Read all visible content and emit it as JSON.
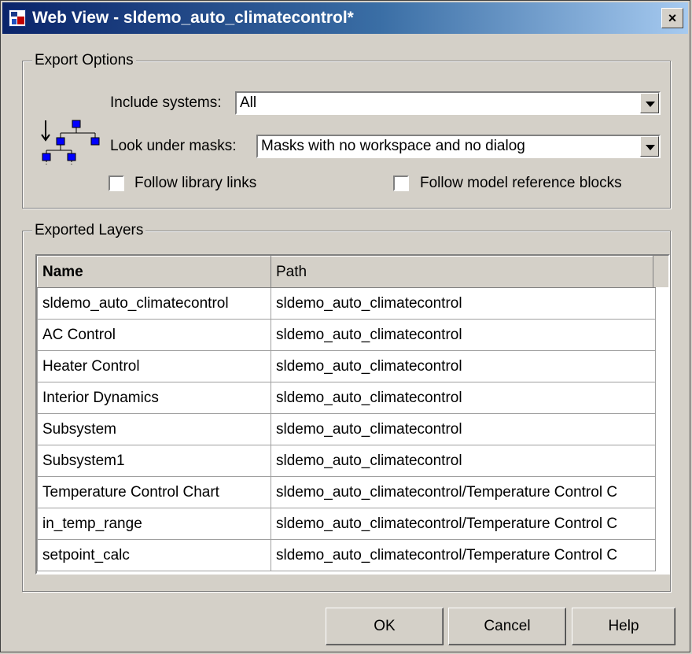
{
  "window": {
    "title": "Web View - sldemo_auto_climatecontrol*",
    "close_glyph": "×"
  },
  "export_options": {
    "legend": "Export Options",
    "include_systems_label": "Include systems:",
    "include_systems_value": "All",
    "look_under_masks_label": "Look under masks:",
    "look_under_masks_value": "Masks with no workspace and no dialog",
    "follow_library_links_label": "Follow library links",
    "follow_library_links_checked": false,
    "follow_model_ref_label": "Follow model reference blocks",
    "follow_model_ref_checked": false,
    "hierarchy_icon": "hierarchy-icon"
  },
  "exported_layers": {
    "legend": "Exported Layers",
    "columns": [
      "Name",
      "Path"
    ],
    "rows": [
      [
        "sldemo_auto_climatecontrol",
        "sldemo_auto_climatecontrol"
      ],
      [
        "AC Control",
        "sldemo_auto_climatecontrol"
      ],
      [
        "Heater Control",
        "sldemo_auto_climatecontrol"
      ],
      [
        "Interior Dynamics",
        "sldemo_auto_climatecontrol"
      ],
      [
        "Subsystem",
        "sldemo_auto_climatecontrol"
      ],
      [
        "Subsystem1",
        "sldemo_auto_climatecontrol"
      ],
      [
        "Temperature Control Chart",
        "sldemo_auto_climatecontrol/Temperature Control C"
      ],
      [
        "in_temp_range",
        "sldemo_auto_climatecontrol/Temperature Control C"
      ],
      [
        "setpoint_calc",
        "sldemo_auto_climatecontrol/Temperature Control C"
      ]
    ]
  },
  "buttons": {
    "ok": "OK",
    "cancel": "Cancel",
    "help": "Help"
  }
}
